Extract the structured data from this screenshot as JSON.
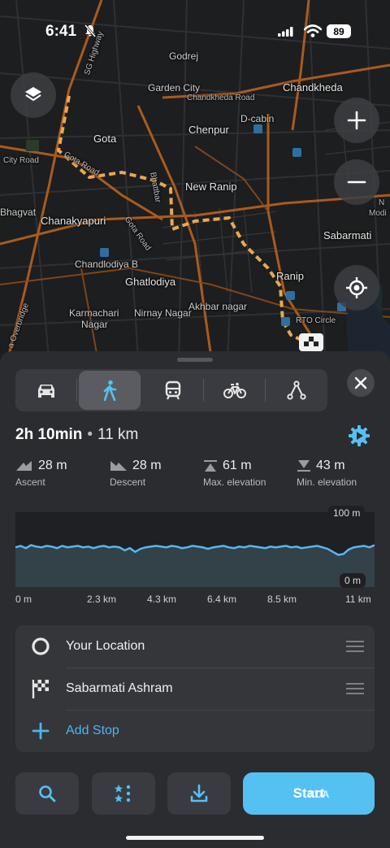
{
  "status_bar": {
    "time": "6:41",
    "battery": "89"
  },
  "map": {
    "labels": {
      "sg_highway": "SG Highway",
      "godrej": "Godrej",
      "garden_city": "Garden City",
      "chandkheda_road": "Chandkheda Road",
      "chandkheda": "Chandkheda",
      "d_cabin": "D-cabin",
      "chenpur": "Chenpur",
      "gota": "Gota",
      "city_road": "City Road",
      "gota_road": "Gota Road",
      "new_ranip": "New Ranip",
      "na": "N",
      "modi": "Modi",
      "bhagvat": "Bhagvat",
      "chanakyapuri": "Chanakyapuri",
      "gota_road_2": "Gota Road",
      "sabarmati": "Sabarmati",
      "chandlodiya_b": "Chandlodiya B",
      "ranip": "Ranip",
      "ghatlodiya": "Ghatlodiya",
      "nirnay_nagar": "Nirnay Nagar",
      "rto_circle": "RTO Circle",
      "karmachari": "Karmachari",
      "nagar": "Nagar",
      "akhbar_nagar": "Akhbar nagar",
      "overbridge": "a Overbridge",
      "bhattbar": "Bhattbar"
    }
  },
  "transport_modes": [
    "car",
    "walk",
    "transit",
    "bicycle",
    "ruler"
  ],
  "selected_mode": "walk",
  "route": {
    "duration": "2h 10min",
    "separator": "•",
    "distance": "11 km"
  },
  "stats": [
    {
      "value": "28 m",
      "label": "Ascent"
    },
    {
      "value": "28 m",
      "label": "Descent"
    },
    {
      "value": "61 m",
      "label": "Max. elevation"
    },
    {
      "value": "43 m",
      "label": "Min. elevation"
    }
  ],
  "elevation": {
    "max_label": "100 m",
    "min_label": "0 m",
    "ticks": [
      "0 m",
      "2.3 km",
      "4.3 km",
      "6.4 km",
      "8.5 km",
      "11 km"
    ],
    "profile": [
      53,
      55,
      52,
      56,
      54,
      53,
      55,
      54,
      52,
      55,
      53,
      54,
      55,
      53,
      54,
      52,
      54,
      55,
      53,
      54,
      53,
      49,
      52,
      47,
      51,
      53,
      54,
      55,
      54,
      53,
      55,
      54,
      52,
      53,
      55,
      54,
      53,
      51,
      53,
      54,
      55,
      53,
      52,
      54,
      53,
      55,
      54,
      53,
      52,
      54,
      53,
      54,
      55,
      53,
      54,
      52,
      53,
      54,
      55,
      53,
      51,
      47,
      43,
      44,
      50,
      53,
      54,
      55,
      53,
      56
    ]
  },
  "stops": [
    {
      "name": "Your Location",
      "icon": "circle-outline-icon"
    },
    {
      "name": "Sabarmati Ashram",
      "icon": "checkered-flag-icon"
    }
  ],
  "add_stop_label": "Add Stop",
  "start_label": "Start",
  "watermark": "XDA",
  "colors": {
    "accent": "#55c1f2",
    "route": "#e8a852",
    "profile_line": "#59b6ef"
  }
}
